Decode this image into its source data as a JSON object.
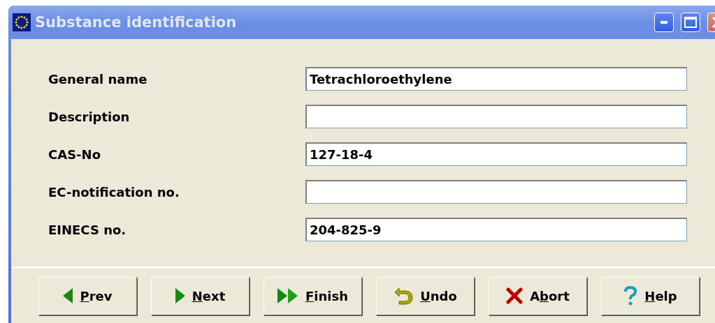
{
  "window": {
    "title": "Substance identification"
  },
  "fields": [
    {
      "label": "General name",
      "value": "Tetrachloroethylene"
    },
    {
      "label": "Description"
    },
    {
      "label": "CAS-No",
      "value": "127-18-4"
    },
    {
      "label": "EC-notification no."
    },
    {
      "label": "EINECS no.",
      "value": "204-825-9"
    }
  ],
  "buttons": [
    {
      "kind": "prev",
      "mnemonic": "P",
      "label_after": "rev"
    },
    {
      "kind": "next",
      "mnemonic": "N",
      "label_after": "ext"
    },
    {
      "kind": "finish",
      "mnemonic": "F",
      "label_after": "inish"
    },
    {
      "kind": "undo",
      "mnemonic": "U",
      "label_after": "ndo"
    },
    {
      "kind": "abort",
      "label_before": "A",
      "mnemonic": "b",
      "label_after": "ort"
    },
    {
      "kind": "help",
      "mnemonic": "H",
      "label_after": "elp"
    }
  ]
}
